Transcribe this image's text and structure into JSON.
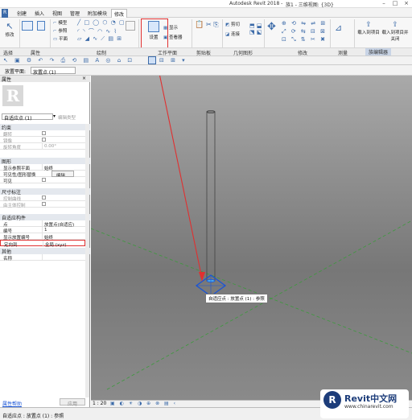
{
  "app": {
    "title": "Autodesk Revit 2018 -",
    "doc": "族1 - 三维视图: {3D}"
  },
  "tabs": [
    "创建",
    "插入",
    "视图",
    "管理",
    "附加模块",
    "修改"
  ],
  "active_tab": "修改",
  "ribbon": {
    "modify_label": "修改",
    "settings_label": "设置",
    "show_label": "显示",
    "viewer_label": "查看器",
    "cut_label": "剪切",
    "join_label": "连接",
    "load_project_label": "载入到项目",
    "load_project_close_label": "载入到项目并关闭",
    "draw_items": [
      "模型",
      "参照",
      "平面"
    ],
    "panel_labels": {
      "select": "选择",
      "properties": "属性",
      "draw": "绘制",
      "workplane": "工作平面",
      "clipboard": "剪贴板",
      "geometry": "几何图形",
      "modify": "修改",
      "measure": "测量",
      "family_editor": "族编辑器"
    }
  },
  "options_bar": {
    "label": "放置平面:",
    "value": "放置点 (1)"
  },
  "properties": {
    "title": "属性",
    "type_selector": "自适应点 (1)",
    "edit_type": "编辑类型",
    "sections": [
      {
        "name": "约束",
        "rows": [
          {
            "k": "翻转",
            "v": "",
            "cb": true,
            "dim": true
          },
          {
            "k": "镜像",
            "v": "",
            "cb": true,
            "dim": true
          },
          {
            "k": "旋转角度",
            "v": "0.00°",
            "dim": true
          }
        ]
      },
      {
        "name": "图形",
        "rows": [
          {
            "k": "显示参照平面",
            "v": "始终"
          },
          {
            "k": "可见性/图形替换",
            "v": "编辑..."
          },
          {
            "k": "可见",
            "v": "",
            "cb": true
          }
        ]
      },
      {
        "name": "尺寸标注",
        "rows": [
          {
            "k": "控制曲线",
            "v": "",
            "cb": true,
            "dim": true
          },
          {
            "k": "由主体控制",
            "v": "",
            "cb": true,
            "dim": true
          }
        ]
      },
      {
        "name": "自适应构件",
        "rows": [
          {
            "k": "点",
            "v": "放置点(自适应)"
          },
          {
            "k": "编号",
            "v": "1"
          },
          {
            "k": "显示放置编号",
            "v": "始终"
          },
          {
            "k": "定向到",
            "v": "全局 (xyz)"
          }
        ]
      },
      {
        "name": "其他",
        "rows": [
          {
            "k": "名称",
            "v": ""
          }
        ]
      }
    ],
    "help_link": "属性帮助",
    "apply_button": "应用"
  },
  "canvas": {
    "tooltip": "自适应点 : 放置点 (1) : 参照"
  },
  "viewbar": {
    "scale": "1 : 20"
  },
  "status": {
    "text": "自适应点 : 放置点 (1) : 参照"
  },
  "watermark": {
    "brand": "Revit中文网",
    "url": "www.chinarevit.com"
  },
  "colors": {
    "highlight": "#e03030",
    "selection": "#1a55d6",
    "workplane": "#3c9a3c",
    "canvas": "#8c8c8c"
  }
}
